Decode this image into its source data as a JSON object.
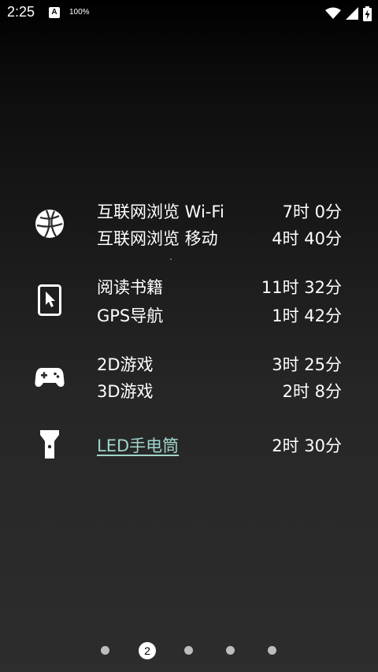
{
  "status_bar": {
    "time": "2:25",
    "notification_letter": "A",
    "battery_percent": "100%",
    "icons": [
      "wifi-icon",
      "signal-icon",
      "battery-charging-icon"
    ]
  },
  "usage": {
    "sections": [
      {
        "icon": "globe-icon",
        "items": [
          {
            "label": "互联网浏览 Wi-Fi",
            "value": "7时 0分"
          },
          {
            "label": "互联网浏览 移动",
            "value": "4时 40分"
          }
        ]
      },
      {
        "icon": "tablet-touch-icon",
        "items": [
          {
            "label": "阅读书籍",
            "value": "11时 32分"
          },
          {
            "label": "GPS导航",
            "value": "1时 42分"
          }
        ]
      },
      {
        "icon": "gamepad-icon",
        "items": [
          {
            "label": "2D游戏",
            "value": "3时 25分"
          },
          {
            "label": "3D游戏",
            "value": "2时 8分"
          }
        ]
      },
      {
        "icon": "flashlight-icon",
        "items": [
          {
            "label": "LED手电筒",
            "value": "2时 30分"
          }
        ]
      }
    ]
  },
  "pager": {
    "current_page": "2",
    "total_pages": 5
  },
  "colors": {
    "link": "#9fd4cc",
    "text": "#ffffff",
    "dot_inactive": "#bdbdbd"
  }
}
